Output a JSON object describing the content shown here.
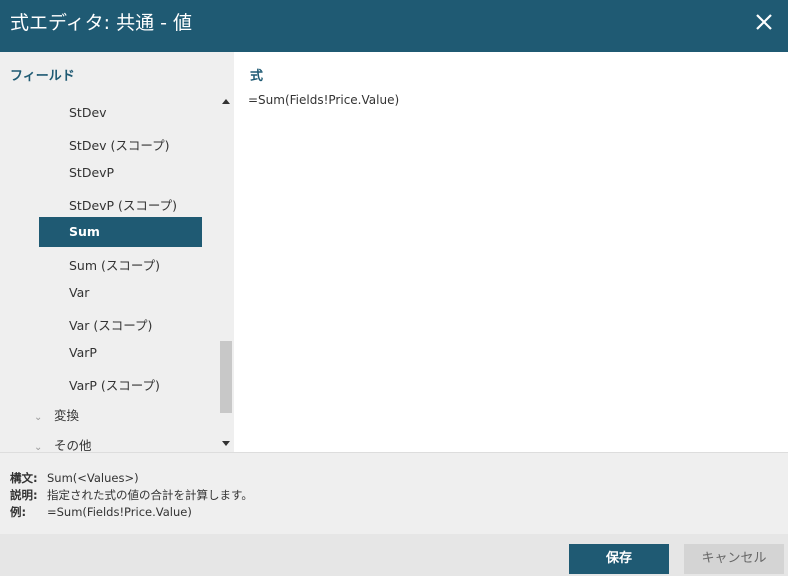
{
  "window": {
    "title": "式エディタ: 共通 - 値",
    "close_icon": "close-icon"
  },
  "fields_panel": {
    "header": "フィールド",
    "items": [
      {
        "label": "StDev",
        "type": "function"
      },
      {
        "label": "StDev (スコープ)",
        "type": "function"
      },
      {
        "label": "StDevP",
        "type": "function"
      },
      {
        "label": "StDevP (スコープ)",
        "type": "function"
      },
      {
        "label": "Sum",
        "type": "function",
        "selected": true
      },
      {
        "label": "Sum (スコープ)",
        "type": "function"
      },
      {
        "label": "Var",
        "type": "function"
      },
      {
        "label": "Var (スコープ)",
        "type": "function"
      },
      {
        "label": "VarP",
        "type": "function"
      },
      {
        "label": "VarP (スコープ)",
        "type": "function"
      },
      {
        "label": "変換",
        "type": "group"
      },
      {
        "label": "その他",
        "type": "group"
      }
    ]
  },
  "expression": {
    "label": "式",
    "value": "=Sum(Fields!Price.Value)"
  },
  "info": {
    "syntax_key": "構文:",
    "syntax_value": "Sum(<Values>)",
    "description_key": "説明:",
    "description_value": "指定された式の値の合計を計算します。",
    "example_key": "例:",
    "example_value": "=Sum(Fields!Price.Value)"
  },
  "buttons": {
    "save": "保存",
    "cancel": "キャンセル"
  },
  "colors": {
    "accent": "#1f5a73",
    "panel_bg": "#efefef"
  }
}
